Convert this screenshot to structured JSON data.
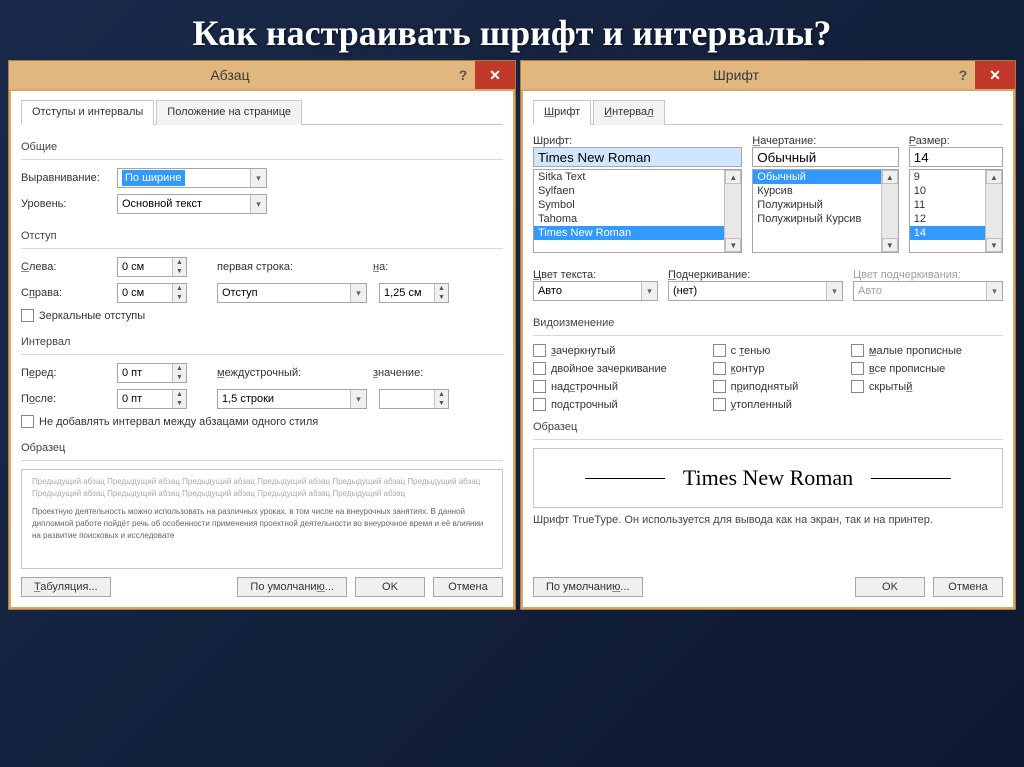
{
  "slide_title": "Как настраивать шрифт и интервалы?",
  "paragraph": {
    "title": "Абзац",
    "tabs": {
      "active": "Отступы и интервалы",
      "inactive": "Положение на странице"
    },
    "general": {
      "group": "Общие",
      "align_label": "Выравнивание:",
      "align_value": "По ширине",
      "level_label": "Уровень:",
      "level_value": "Основной текст"
    },
    "indent": {
      "group": "Отступ",
      "left_label": "Слева:",
      "left_value": "0 см",
      "right_label": "Справа:",
      "right_value": "0 см",
      "first_label": "первая строка:",
      "first_value": "Отступ",
      "by_label": "на:",
      "by_value": "1,25 см",
      "mirror": "Зеркальные отступы"
    },
    "spacing": {
      "group": "Интервал",
      "before_label": "Перед:",
      "before_value": "0 пт",
      "after_label": "После:",
      "after_value": "0 пт",
      "line_label": "междустрочный:",
      "line_value": "1,5 строки",
      "at_label": "значение:",
      "at_value": "",
      "same_style": "Не добавлять интервал между абзацами одного стиля"
    },
    "preview": {
      "label": "Образец",
      "lorem1": "Предыдущий абзац Предыдущий абзац Предыдущий абзац Предыдущий абзац Предыдущий абзац Предыдущий абзац Предыдущий абзац Предыдущий абзац Предыдущий абзац Предыдущий абзац Предыдущий абзац",
      "lorem2": "Проектную деятельность можно использовать на различных уроках, в том числе на внеурочных занятиях. В данной дипломной работе пойдёт речь об особенности применения проектной деятельности во внеурочное время и её влиянии на развитие поисковых и исследовате"
    },
    "buttons": {
      "tabs": "Табуляция...",
      "default": "По умолчанию...",
      "ok": "OK",
      "cancel": "Отмена"
    }
  },
  "font": {
    "title": "Шрифт",
    "tabs": {
      "active": "Шрифт",
      "inactive": "Интервал"
    },
    "pick": {
      "font_label": "Шрифт:",
      "font_value": "Times New Roman",
      "font_list": [
        "Sitka Text",
        "Sylfaen",
        "Symbol",
        "Tahoma",
        "Times New Roman"
      ],
      "style_label": "Начертание:",
      "style_value": "Обычный",
      "style_list": [
        "Обычный",
        "Курсив",
        "Полужирный",
        "Полужирный Курсив"
      ],
      "size_label": "Размер:",
      "size_value": "14",
      "size_list": [
        "9",
        "10",
        "11",
        "12",
        "14"
      ]
    },
    "color": {
      "text_label": "Цвет текста:",
      "text_value": "Авто",
      "ul_label": "Подчеркивание:",
      "ul_value": "(нет)",
      "ulc_label": "Цвет подчеркивания:",
      "ulc_value": "Авто"
    },
    "effects": {
      "group": "Видоизменение",
      "c1": "зачеркнутый",
      "c2": "с тенью",
      "c3": "малые прописные",
      "c4": "двойное зачеркивание",
      "c5": "контур",
      "c6": "все прописные",
      "c7": "надстрочный",
      "c8": "приподнятый",
      "c9": "скрытый",
      "c10": "подстрочный",
      "c11": "утопленный"
    },
    "preview": {
      "label": "Образец",
      "sample": "Times New Roman",
      "desc": "Шрифт TrueType. Он используется для вывода как на экран, так и на принтер."
    },
    "buttons": {
      "default": "По умолчанию...",
      "ok": "OK",
      "cancel": "Отмена"
    }
  }
}
